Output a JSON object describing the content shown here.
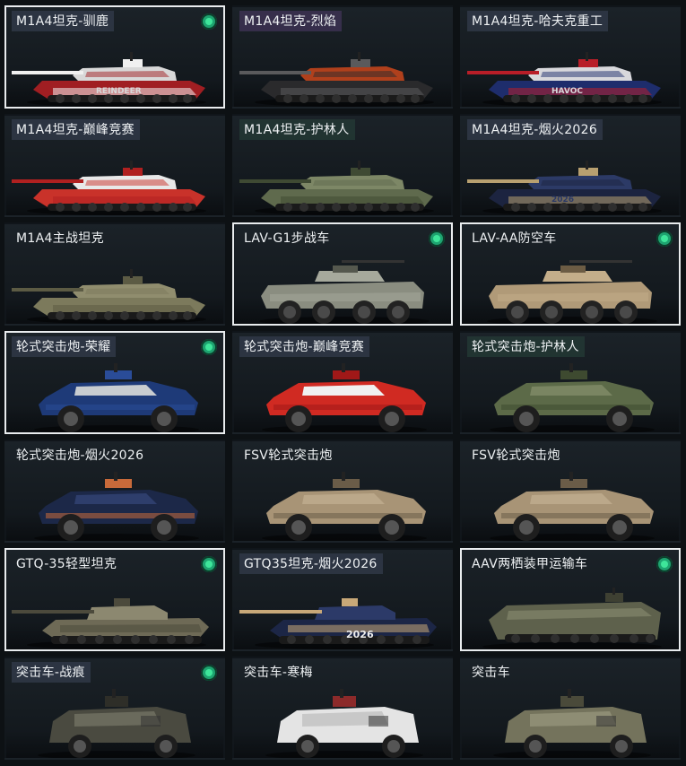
{
  "vehicles": [
    {
      "name": "M1A4坦克-驯鹿",
      "equipped": true,
      "selected": true,
      "kind": "tank",
      "colors": [
        "#a01e22",
        "#d8d8d8",
        "#f0f0f0"
      ],
      "decal": "REINDEER",
      "label_style": "tinted"
    },
    {
      "name": "M1A4坦克-烈焰",
      "equipped": false,
      "selected": false,
      "kind": "tank",
      "colors": [
        "#2a2a2c",
        "#b0401c",
        "#5a5a5c"
      ],
      "decal": "",
      "label_style": "purple"
    },
    {
      "name": "M1A4坦克-哈夫克重工",
      "equipped": false,
      "selected": false,
      "kind": "tank",
      "colors": [
        "#1e2d6c",
        "#d8d8dc",
        "#b81e28"
      ],
      "decal": "HAVOC",
      "label_style": "tinted"
    },
    {
      "name": "M1A4坦克-巅峰竞赛",
      "equipped": false,
      "selected": false,
      "kind": "tank",
      "colors": [
        "#c9322a",
        "#e8e8e8",
        "#b02020"
      ],
      "decal": "",
      "label_style": "tinted"
    },
    {
      "name": "M1A4坦克-护林人",
      "equipped": false,
      "selected": false,
      "kind": "tank",
      "colors": [
        "#5f6a4d",
        "#7d8766",
        "#3f4a33"
      ],
      "decal": "",
      "label_style": "green"
    },
    {
      "name": "M1A4坦克-烟火2026",
      "equipped": false,
      "selected": false,
      "kind": "tank",
      "colors": [
        "#1c2440",
        "#2c3a66",
        "#b8a070"
      ],
      "decal": "2026",
      "label_style": "tinted"
    },
    {
      "name": "M1A4主战坦克",
      "equipped": false,
      "selected": false,
      "kind": "tank",
      "colors": [
        "#7c7a5c",
        "#908d6e",
        "#5c5b44"
      ],
      "decal": "",
      "label_style": "none"
    },
    {
      "name": "LAV-G1步战车",
      "equipped": true,
      "selected": true,
      "kind": "apc8",
      "colors": [
        "#8a8d80",
        "#a6a99c",
        "#55584e"
      ],
      "decal": "",
      "label_style": "none"
    },
    {
      "name": "LAV-AA防空车",
      "equipped": true,
      "selected": true,
      "kind": "apc8",
      "colors": [
        "#b09a78",
        "#c4ae8a",
        "#6c5c44"
      ],
      "decal": "",
      "label_style": "none"
    },
    {
      "name": "轮式突击炮-荣耀",
      "equipped": true,
      "selected": true,
      "kind": "armored4",
      "colors": [
        "#1e3a78",
        "#c8ccd0",
        "#2a4c98"
      ],
      "decal": "",
      "label_style": "tinted"
    },
    {
      "name": "轮式突击炮-巅峰竞赛",
      "equipped": false,
      "selected": false,
      "kind": "armored4",
      "colors": [
        "#d02a22",
        "#f0f0f0",
        "#a01818"
      ],
      "decal": "",
      "label_style": "tinted"
    },
    {
      "name": "轮式突击炮-护林人",
      "equipped": false,
      "selected": false,
      "kind": "armored4",
      "colors": [
        "#5c6a48",
        "#7a8562",
        "#3e4a30"
      ],
      "decal": "",
      "label_style": "green"
    },
    {
      "name": "轮式突击炮-烟火2026",
      "equipped": false,
      "selected": false,
      "kind": "armored4",
      "colors": [
        "#1c2848",
        "#2e3e6c",
        "#c86a3a"
      ],
      "decal": "",
      "label_style": "none"
    },
    {
      "name": "FSV轮式突击炮",
      "equipped": false,
      "selected": false,
      "kind": "armored4",
      "colors": [
        "#a89476",
        "#bba88a",
        "#6a5c48"
      ],
      "decal": "",
      "label_style": "none"
    },
    {
      "name": "FSV轮式突击炮",
      "equipped": false,
      "selected": false,
      "kind": "armored4",
      "colors": [
        "#a89476",
        "#bba88a",
        "#6a5c48"
      ],
      "decal": "",
      "label_style": "none"
    },
    {
      "name": "GTQ-35轻型坦克",
      "equipped": true,
      "selected": true,
      "kind": "lighttank",
      "colors": [
        "#6e6a56",
        "#8c8870",
        "#4c4a3c"
      ],
      "decal": "",
      "label_style": "none"
    },
    {
      "name": "GTQ35坦克-烟火2026",
      "equipped": false,
      "selected": false,
      "kind": "lighttank",
      "colors": [
        "#1c2646",
        "#2c3a68",
        "#c8a878"
      ],
      "decal": "2026",
      "label_style": "tinted"
    },
    {
      "name": "AAV两栖装甲运输车",
      "equipped": true,
      "selected": true,
      "kind": "aav",
      "colors": [
        "#5e614c",
        "#787b62",
        "#3e4032"
      ],
      "decal": "",
      "label_style": "none"
    },
    {
      "name": "突击车-战痕",
      "equipped": true,
      "selected": false,
      "kind": "mrap",
      "colors": [
        "#4a4a40",
        "#6a6a5c",
        "#2e2e28"
      ],
      "decal": "",
      "label_style": "tinted"
    },
    {
      "name": "突击车-寒梅",
      "equipped": false,
      "selected": false,
      "kind": "mrap",
      "colors": [
        "#e4e4e4",
        "#c8c8c8",
        "#8c2a2a"
      ],
      "decal": "",
      "label_style": "none"
    },
    {
      "name": "突击车",
      "equipped": false,
      "selected": false,
      "kind": "mrap",
      "colors": [
        "#74735c",
        "#8e8d74",
        "#4a4a3a"
      ],
      "decal": "",
      "label_style": "none"
    }
  ]
}
